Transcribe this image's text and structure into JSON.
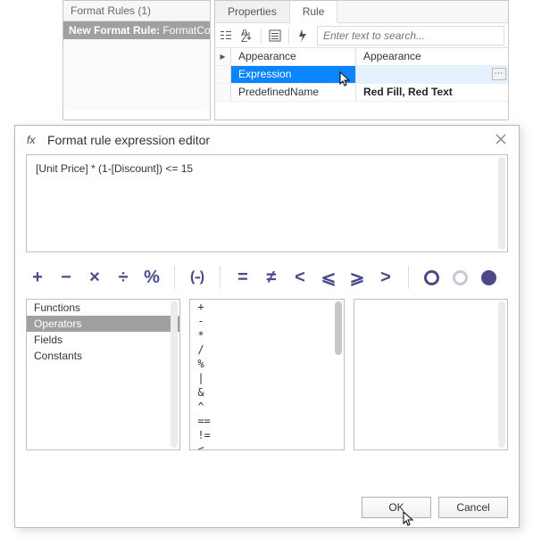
{
  "rules_panel": {
    "header": "Format Rules (1)",
    "item_prefix": "New Format Rule:",
    "item_type": " FormatCon"
  },
  "tabs": {
    "properties": "Properties",
    "rule": "Rule"
  },
  "search": {
    "placeholder": "Enter text to search..."
  },
  "grid": {
    "rows": [
      {
        "key": "Appearance",
        "val": "Appearance"
      },
      {
        "key": "Expression",
        "val": ""
      },
      {
        "key": "PredefinedName",
        "val": "Red Fill, Red Text"
      }
    ]
  },
  "dialog": {
    "title": "Format rule expression editor",
    "expression": "[Unit Price] * (1-[Discount]) <= 15",
    "categories": [
      "Functions",
      "Operators",
      "Fields",
      "Constants"
    ],
    "selected_category": "Operators",
    "operators_list": [
      "+",
      "-",
      "*",
      "/",
      "%",
      "|",
      "&",
      "^",
      "==",
      "!=",
      "<"
    ],
    "buttons": {
      "ok": "OK",
      "cancel": "Cancel"
    }
  }
}
